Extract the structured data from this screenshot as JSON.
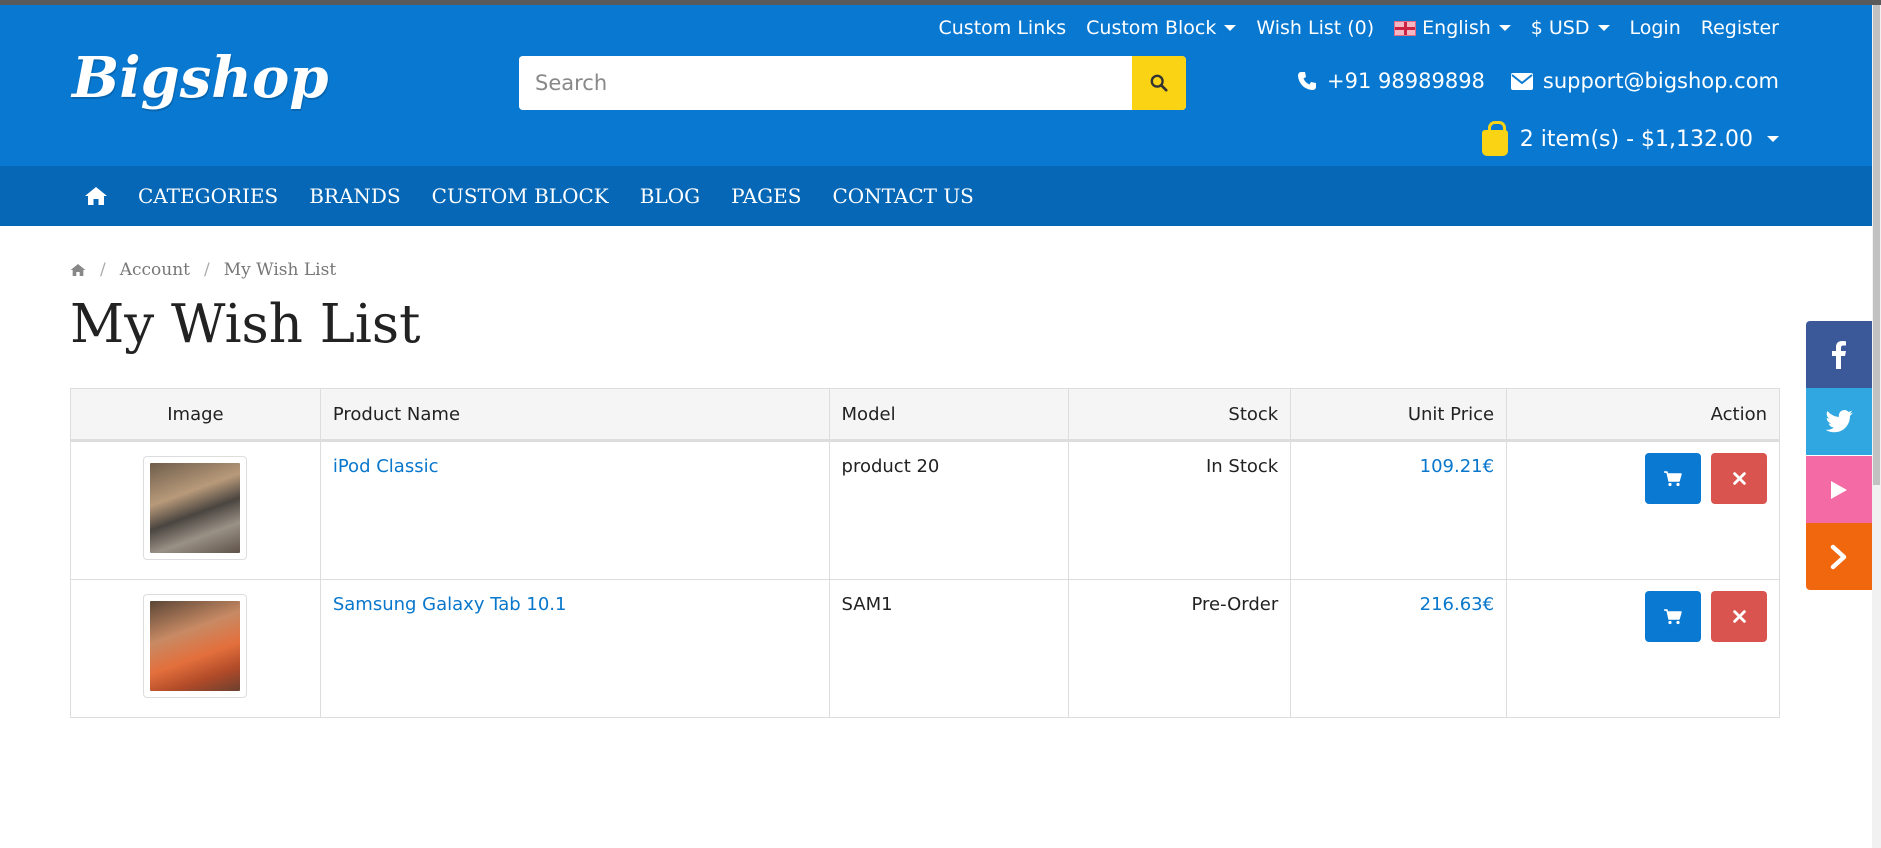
{
  "header": {
    "logo": "Bigshop",
    "top_links": {
      "custom_links": "Custom Links",
      "custom_block": "Custom Block",
      "wish_list": "Wish List (0)",
      "language": "English",
      "currency": "$ USD",
      "login": "Login",
      "register": "Register"
    },
    "search": {
      "placeholder": "Search"
    },
    "phone": "+91 98989898",
    "email": "support@bigshop.com",
    "cart": "2 item(s) - $1,132.00"
  },
  "nav": {
    "items": [
      "CATEGORIES",
      "BRANDS",
      "CUSTOM BLOCK",
      "BLOG",
      "PAGES",
      "CONTACT US"
    ]
  },
  "breadcrumb": {
    "items": [
      "Account",
      "My Wish List"
    ]
  },
  "page_title": "My Wish List",
  "wishlist": {
    "columns": {
      "image": "Image",
      "name": "Product Name",
      "model": "Model",
      "stock": "Stock",
      "price": "Unit Price",
      "action": "Action"
    },
    "rows": [
      {
        "name": "iPod Classic",
        "model": "product 20",
        "stock": "In Stock",
        "price": "109.21€"
      },
      {
        "name": "Samsung Galaxy Tab 10.1",
        "model": "SAM1",
        "stock": "Pre-Order",
        "price": "216.63€"
      }
    ]
  },
  "colors": {
    "header_blue": "#0878d1",
    "nav_blue": "#0567b6",
    "accent_yellow": "#fad414",
    "link_blue": "#0877cc",
    "delete_red": "#d9534f",
    "facebook": "#3b5998",
    "twitter": "#30a7e0",
    "youtube": "#f36aa4",
    "more": "#f0670e"
  },
  "icons": {
    "home": "home-icon",
    "search": "search-icon",
    "phone": "phone-icon",
    "mail": "envelope-icon",
    "cart": "shopping-bag-icon",
    "add_to_cart": "cart-icon",
    "remove": "close-icon",
    "social": [
      "facebook-icon",
      "twitter-icon",
      "play-icon",
      "chevron-right-icon"
    ]
  }
}
